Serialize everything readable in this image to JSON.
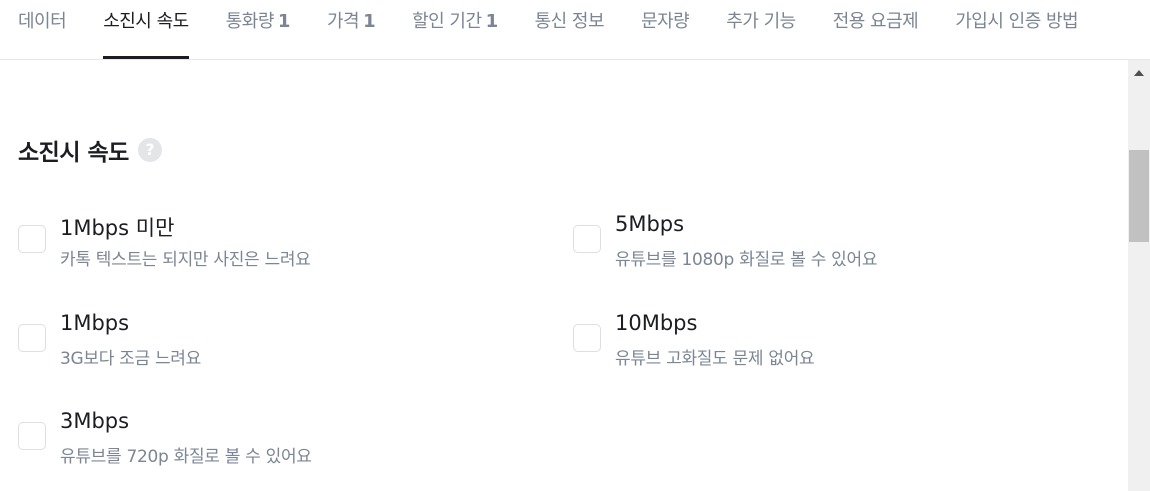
{
  "tabs": [
    {
      "label": "데이터",
      "count": "",
      "active": false
    },
    {
      "label": "소진시 속도",
      "count": "",
      "active": true
    },
    {
      "label": "통화량",
      "count": "1",
      "active": false
    },
    {
      "label": "가격",
      "count": "1",
      "active": false
    },
    {
      "label": "할인 기간",
      "count": "1",
      "active": false
    },
    {
      "label": "통신 정보",
      "count": "",
      "active": false
    },
    {
      "label": "문자량",
      "count": "",
      "active": false
    },
    {
      "label": "추가 기능",
      "count": "",
      "active": false
    },
    {
      "label": "전용 요금제",
      "count": "",
      "active": false
    },
    {
      "label": "가입시 인증 방법",
      "count": "",
      "active": false
    }
  ],
  "section": {
    "title": "소진시 속도",
    "help_icon": "?"
  },
  "options": [
    {
      "label": "1Mbps 미만",
      "desc": "카톡 텍스트는 되지만 사진은 느려요",
      "checked": false
    },
    {
      "label": "5Mbps",
      "desc": "유튜브를 1080p 화질로 볼 수 있어요",
      "checked": false
    },
    {
      "label": "1Mbps",
      "desc": "3G보다 조금 느려요",
      "checked": false
    },
    {
      "label": "10Mbps",
      "desc": "유튜브 고화질도 문제 없어요",
      "checked": false
    },
    {
      "label": "3Mbps",
      "desc": "유튜브를 720p 화질로 볼 수 있어요",
      "checked": false
    }
  ],
  "colors": {
    "accent": "#1b1d22",
    "muted_text": "#7c8594",
    "border": "#dcdfe3"
  }
}
